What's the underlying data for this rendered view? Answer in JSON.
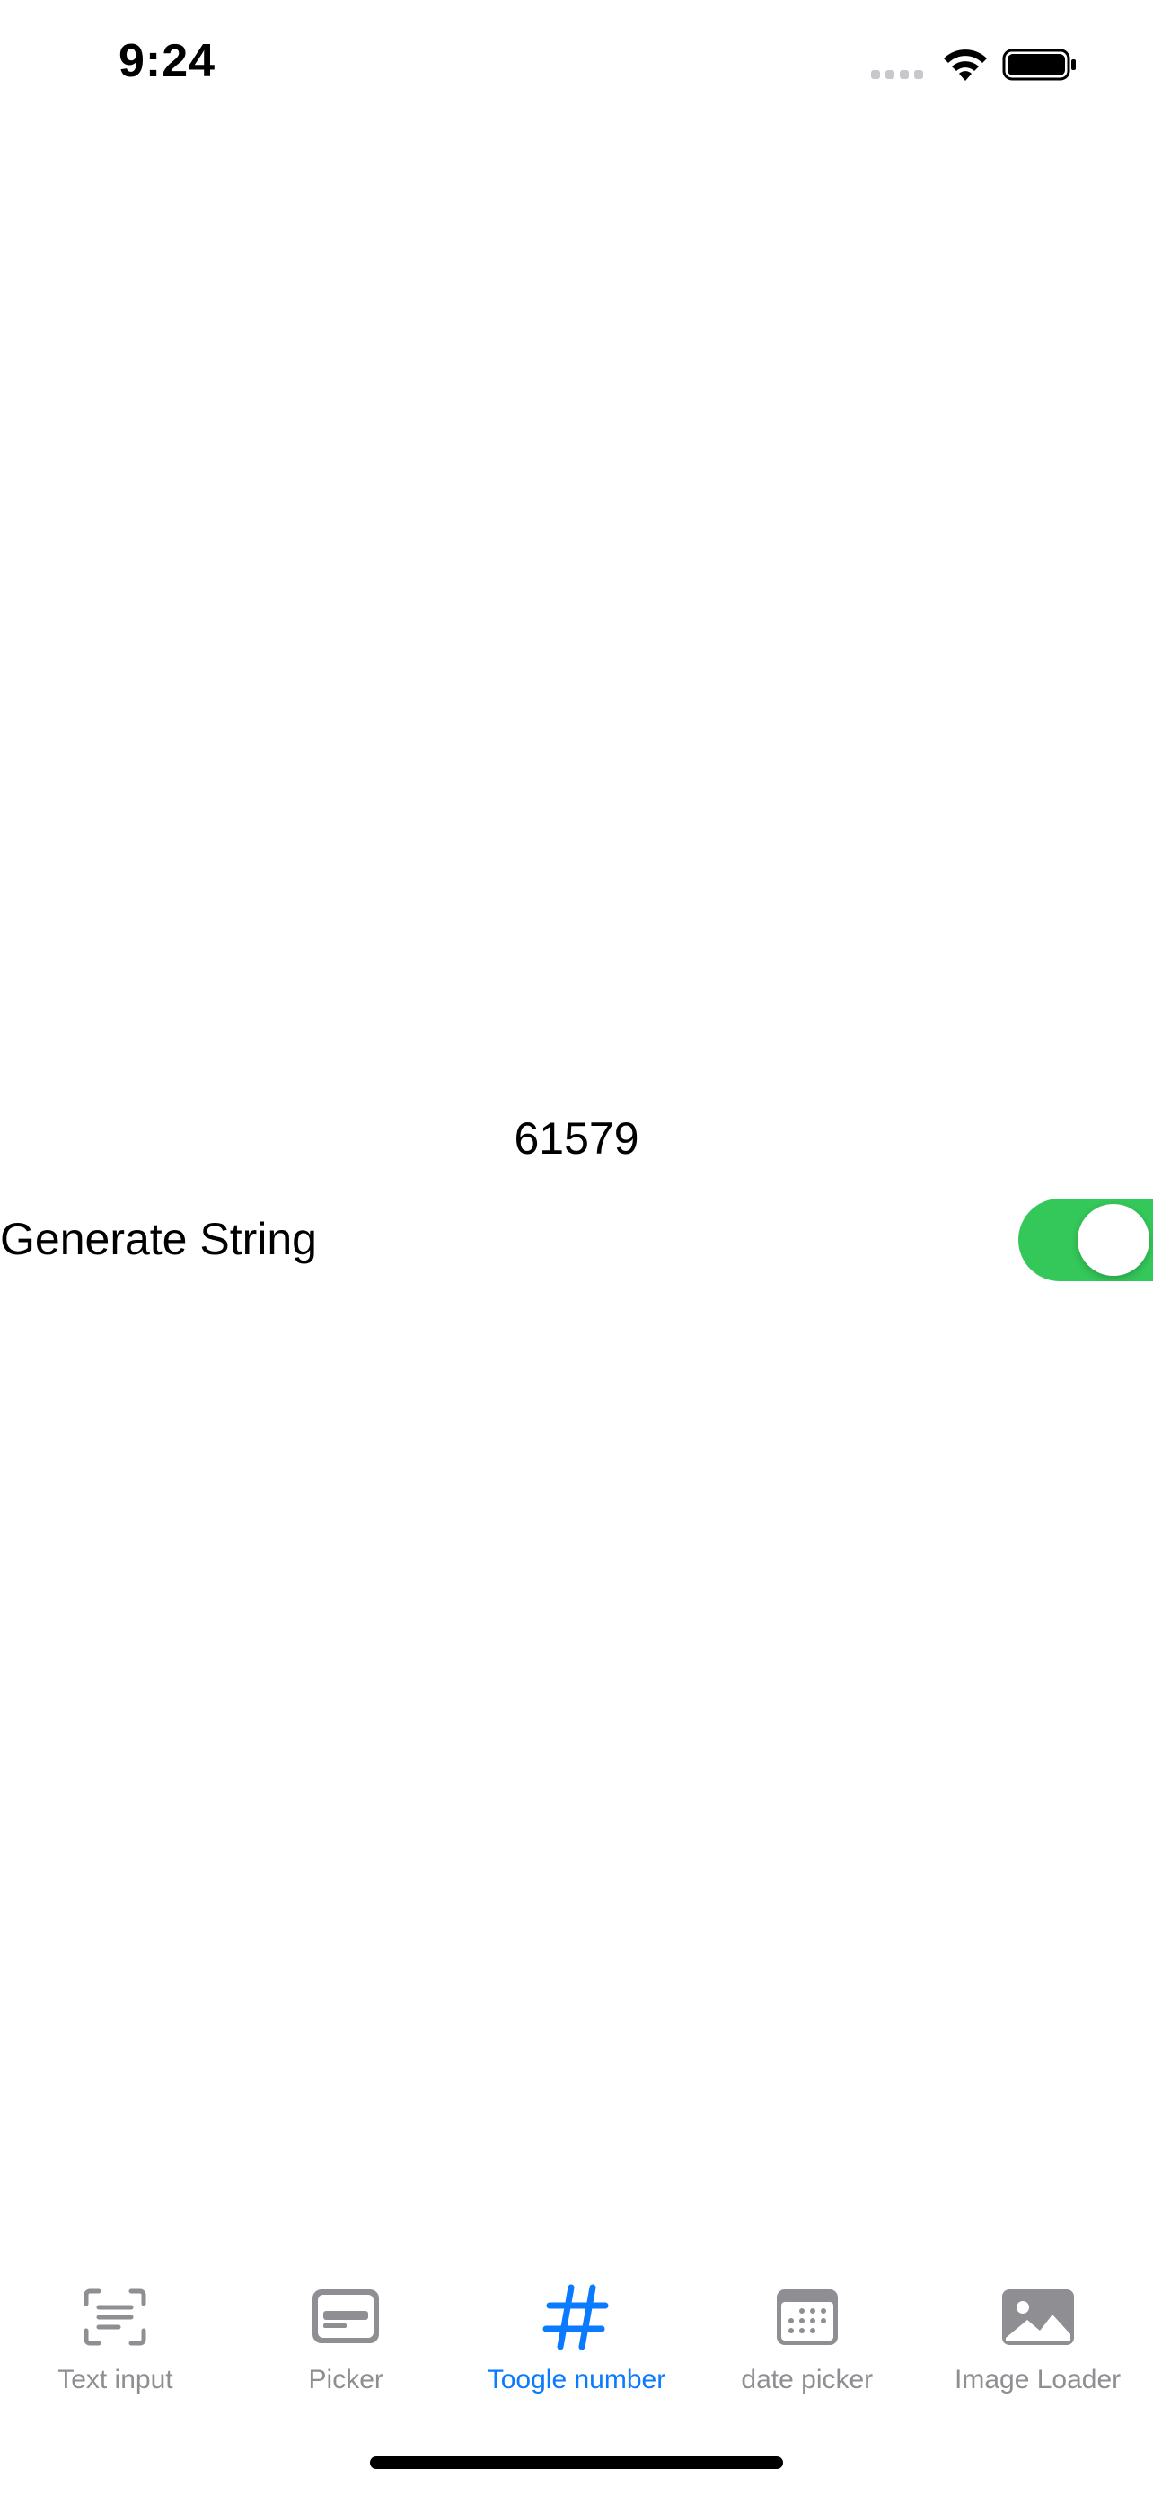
{
  "status_bar": {
    "time": "9:24"
  },
  "main": {
    "number_value": "61579",
    "toggle_label": "Generate String",
    "toggle_on": true
  },
  "tab_bar": {
    "tabs": [
      {
        "label": "Text input",
        "icon": "text-viewfinder-icon",
        "active": false
      },
      {
        "label": "Picker",
        "icon": "picker-card-icon",
        "active": false
      },
      {
        "label": "Toogle number",
        "icon": "number-sign-icon",
        "active": true
      },
      {
        "label": "date picker",
        "icon": "calendar-icon",
        "active": false
      },
      {
        "label": "Image Loader",
        "icon": "photo-icon",
        "active": false
      }
    ]
  },
  "colors": {
    "accent": "#0a7aff",
    "toggle_on": "#34c759",
    "inactive": "#8e8e93"
  }
}
